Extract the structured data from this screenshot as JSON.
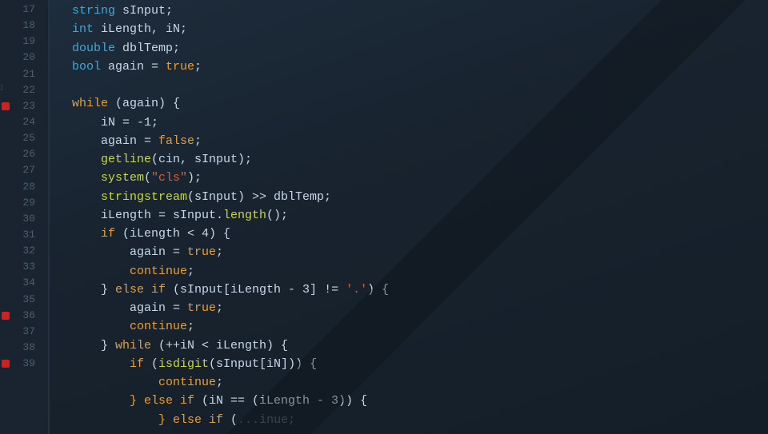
{
  "editor": {
    "theme": "dark",
    "background": "#1a2330",
    "accent": "#3fa8d5"
  },
  "lines": [
    {
      "num": 17,
      "breakpoint": false,
      "collapsible": false,
      "tokens": [
        {
          "type": "kw-type",
          "text": "string"
        },
        {
          "type": "ident",
          "text": " sInput;"
        }
      ]
    },
    {
      "num": 18,
      "breakpoint": false,
      "collapsible": false,
      "tokens": [
        {
          "type": "kw-type",
          "text": "int"
        },
        {
          "type": "ident",
          "text": " iLength, iN;"
        }
      ]
    },
    {
      "num": 19,
      "breakpoint": false,
      "collapsible": false,
      "tokens": [
        {
          "type": "kw-type",
          "text": "double"
        },
        {
          "type": "ident",
          "text": " dblTemp;"
        }
      ]
    },
    {
      "num": 20,
      "breakpoint": false,
      "collapsible": false,
      "tokens": [
        {
          "type": "kw-type",
          "text": "bool"
        },
        {
          "type": "ident",
          "text": " again = "
        },
        {
          "type": "kw-val",
          "text": "true"
        },
        {
          "type": "ident",
          "text": ";"
        }
      ]
    },
    {
      "num": 21,
      "breakpoint": false,
      "collapsible": false,
      "tokens": []
    },
    {
      "num": 22,
      "breakpoint": false,
      "collapsible": true,
      "tokens": [
        {
          "type": "kw-ctrl",
          "text": "while"
        },
        {
          "type": "ident",
          "text": " (again) {"
        }
      ]
    },
    {
      "num": 23,
      "breakpoint": true,
      "collapsible": false,
      "tokens": [
        {
          "type": "ident",
          "text": "    iN = -1;"
        }
      ]
    },
    {
      "num": 24,
      "breakpoint": false,
      "collapsible": false,
      "tokens": [
        {
          "type": "ident",
          "text": "    again = "
        },
        {
          "type": "kw-val",
          "text": "false"
        },
        {
          "type": "ident",
          "text": ";"
        }
      ]
    },
    {
      "num": 25,
      "breakpoint": false,
      "collapsible": false,
      "tokens": [
        {
          "type": "kw-func",
          "text": "    getline"
        },
        {
          "type": "ident",
          "text": "(cin, sInput);"
        }
      ]
    },
    {
      "num": 26,
      "breakpoint": false,
      "collapsible": false,
      "tokens": [
        {
          "type": "kw-func",
          "text": "    system"
        },
        {
          "type": "ident",
          "text": "("
        },
        {
          "type": "str",
          "text": "\"cls\""
        },
        {
          "type": "ident",
          "text": ");"
        }
      ]
    },
    {
      "num": 27,
      "breakpoint": false,
      "collapsible": false,
      "tokens": [
        {
          "type": "kw-func",
          "text": "    stringstream"
        },
        {
          "type": "ident",
          "text": "(sInput) >> dblTemp;"
        }
      ]
    },
    {
      "num": 28,
      "breakpoint": false,
      "collapsible": false,
      "tokens": [
        {
          "type": "ident",
          "text": "    iLength = sInput."
        },
        {
          "type": "kw-func",
          "text": "length"
        },
        {
          "type": "ident",
          "text": "();"
        }
      ]
    },
    {
      "num": 29,
      "breakpoint": false,
      "collapsible": false,
      "tokens": [
        {
          "type": "kw-ctrl",
          "text": "    if"
        },
        {
          "type": "ident",
          "text": " (iLength < 4) {"
        }
      ]
    },
    {
      "num": 30,
      "breakpoint": false,
      "collapsible": false,
      "tokens": [
        {
          "type": "ident",
          "text": "        again = "
        },
        {
          "type": "kw-val",
          "text": "true"
        },
        {
          "type": "ident",
          "text": ";"
        }
      ]
    },
    {
      "num": 31,
      "breakpoint": false,
      "collapsible": false,
      "tokens": [
        {
          "type": "kw-ctrl",
          "text": "        continue"
        },
        {
          "type": "ident",
          "text": ";"
        }
      ]
    },
    {
      "num": 32,
      "breakpoint": false,
      "collapsible": false,
      "tokens": [
        {
          "type": "ident",
          "text": "    } "
        },
        {
          "type": "kw-ctrl",
          "text": "else if"
        },
        {
          "type": "ident",
          "text": " (sInput[iLength - 3] != "
        },
        {
          "type": "str",
          "text": "'.'"
        },
        {
          "type": "ident",
          "text": ") {"
        }
      ]
    },
    {
      "num": 33,
      "breakpoint": false,
      "collapsible": false,
      "tokens": [
        {
          "type": "ident",
          "text": "        again = "
        },
        {
          "type": "kw-val",
          "text": "true"
        },
        {
          "type": "ident",
          "text": ";"
        }
      ]
    },
    {
      "num": 34,
      "breakpoint": false,
      "collapsible": false,
      "tokens": [
        {
          "type": "kw-ctrl",
          "text": "        continue"
        },
        {
          "type": "ident",
          "text": ";"
        }
      ]
    },
    {
      "num": 35,
      "breakpoint": false,
      "collapsible": false,
      "tokens": [
        {
          "type": "ident",
          "text": "    } "
        },
        {
          "type": "kw-ctrl",
          "text": "while"
        },
        {
          "type": "ident",
          "text": " (++iN < iLength) {"
        }
      ]
    },
    {
      "num": 36,
      "breakpoint": true,
      "collapsible": false,
      "tokens": [
        {
          "type": "kw-ctrl",
          "text": "        if"
        },
        {
          "type": "ident",
          "text": " ("
        },
        {
          "type": "kw-func",
          "text": "isdigit"
        },
        {
          "type": "ident",
          "text": "(sInput[iN])) {"
        }
      ]
    },
    {
      "num": 37,
      "breakpoint": false,
      "collapsible": false,
      "tokens": [
        {
          "type": "kw-ctrl",
          "text": "            continue"
        },
        {
          "type": "ident",
          "text": ";"
        }
      ]
    },
    {
      "num": 38,
      "breakpoint": false,
      "collapsible": false,
      "tokens": [
        {
          "type": "kw-ctrl",
          "text": "        } else if"
        },
        {
          "type": "ident",
          "text": " (iN == (iLength - 3)) {"
        }
      ]
    },
    {
      "num": 39,
      "breakpoint": true,
      "collapsible": false,
      "tokens": [
        {
          "type": "ident",
          "text": "            "
        },
        {
          "type": "kw-ctrl",
          "text": "} else if"
        },
        {
          "type": "ident",
          "text": " ("
        },
        {
          "type": "comment",
          "text": "...inue;"
        }
      ]
    }
  ]
}
